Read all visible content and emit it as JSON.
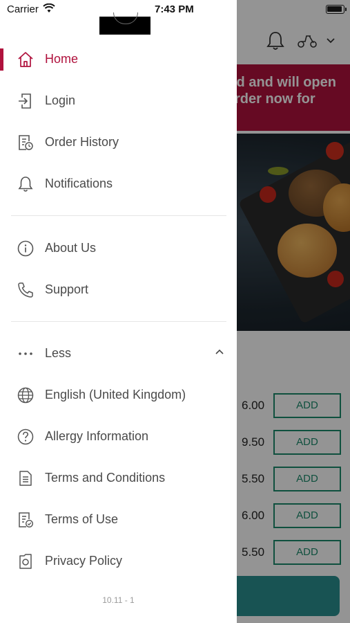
{
  "status_bar": {
    "carrier": "Carrier",
    "time": "7:43 PM"
  },
  "background": {
    "banner_lines": [
      "ed and will open",
      "rder now for"
    ],
    "items": [
      {
        "price": "6.00",
        "button": "ADD"
      },
      {
        "price": "9.50",
        "button": "ADD"
      },
      {
        "price": "5.50",
        "button": "ADD"
      },
      {
        "price": "6.00",
        "button": "ADD"
      },
      {
        "price": "5.50",
        "button": "ADD"
      }
    ]
  },
  "drawer": {
    "primary": [
      {
        "label": "Home",
        "icon": "home-icon",
        "active": true
      },
      {
        "label": "Login",
        "icon": "login-icon"
      },
      {
        "label": "Order History",
        "icon": "order-history-icon"
      },
      {
        "label": "Notifications",
        "icon": "bell-icon"
      }
    ],
    "secondary": [
      {
        "label": "About Us",
        "icon": "info-icon"
      },
      {
        "label": "Support",
        "icon": "phone-icon"
      }
    ],
    "less": {
      "label": "Less"
    },
    "more": [
      {
        "label": "English (United Kingdom)",
        "icon": "globe-icon"
      },
      {
        "label": "Allergy Information",
        "icon": "question-icon"
      },
      {
        "label": "Terms and Conditions",
        "icon": "document-icon"
      },
      {
        "label": "Terms of Use",
        "icon": "document-check-icon"
      },
      {
        "label": "Privacy Policy",
        "icon": "privacy-icon"
      }
    ],
    "version": "10.11 - 1"
  },
  "colors": {
    "accent": "#b0123d",
    "text": "#4a4a4a",
    "add_green": "#1a8a6c"
  }
}
